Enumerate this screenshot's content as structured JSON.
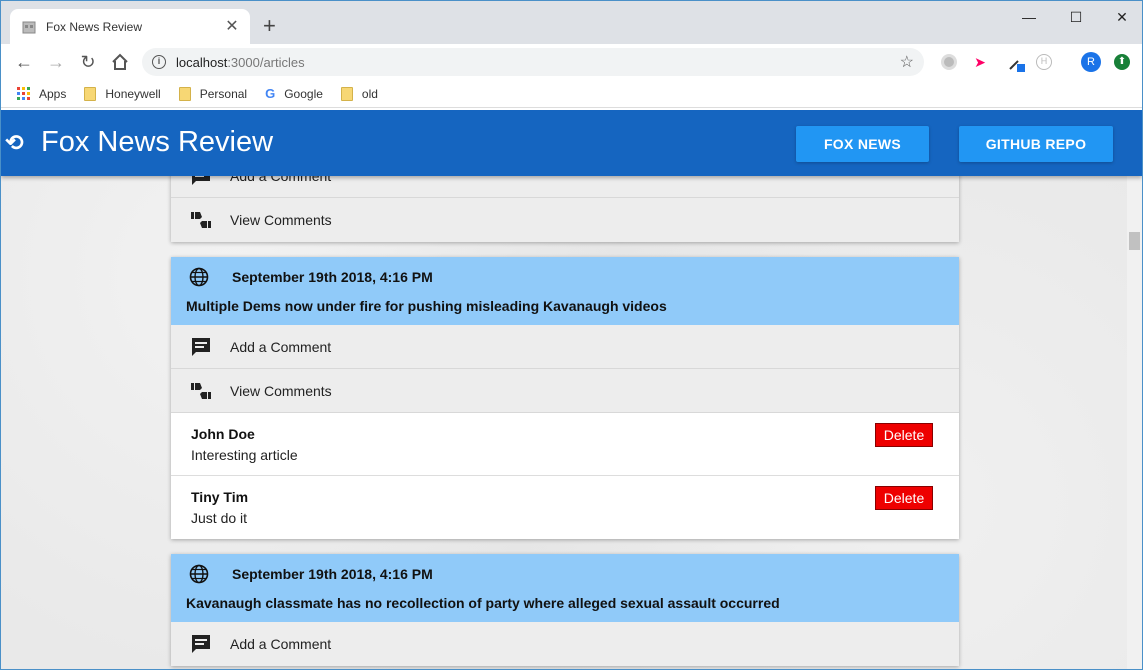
{
  "browser": {
    "tab_title": "Fox News Review",
    "url_host": "localhost",
    "url_path": ":3000/articles",
    "bookmarks": [
      "Apps",
      "Honeywell",
      "Personal",
      "Google",
      "old"
    ],
    "profile_initial": "R"
  },
  "app": {
    "title": "Fox News Review",
    "nav": {
      "fox_news": "FOX NEWS",
      "github": "GITHUB REPO"
    }
  },
  "labels": {
    "add_comment": "Add a Comment",
    "view_comments": "View Comments",
    "delete": "Delete"
  },
  "articles": [
    {
      "date": "September 19th 2018, 4:16 PM",
      "headline": "Multiple Dems now under fire for pushing misleading Kavanaugh videos",
      "comments": [
        {
          "author": "John Doe",
          "text": "Interesting article"
        },
        {
          "author": "Tiny Tim",
          "text": "Just do it"
        }
      ]
    },
    {
      "date": "September 19th 2018, 4:16 PM",
      "headline": "Kavanaugh classmate has no recollection of party where alleged sexual assault occurred",
      "comments": []
    }
  ],
  "colors": {
    "appbar": "#1565c0",
    "button": "#2196f3",
    "card_head": "#90caf9",
    "delete": "#ee0000"
  }
}
